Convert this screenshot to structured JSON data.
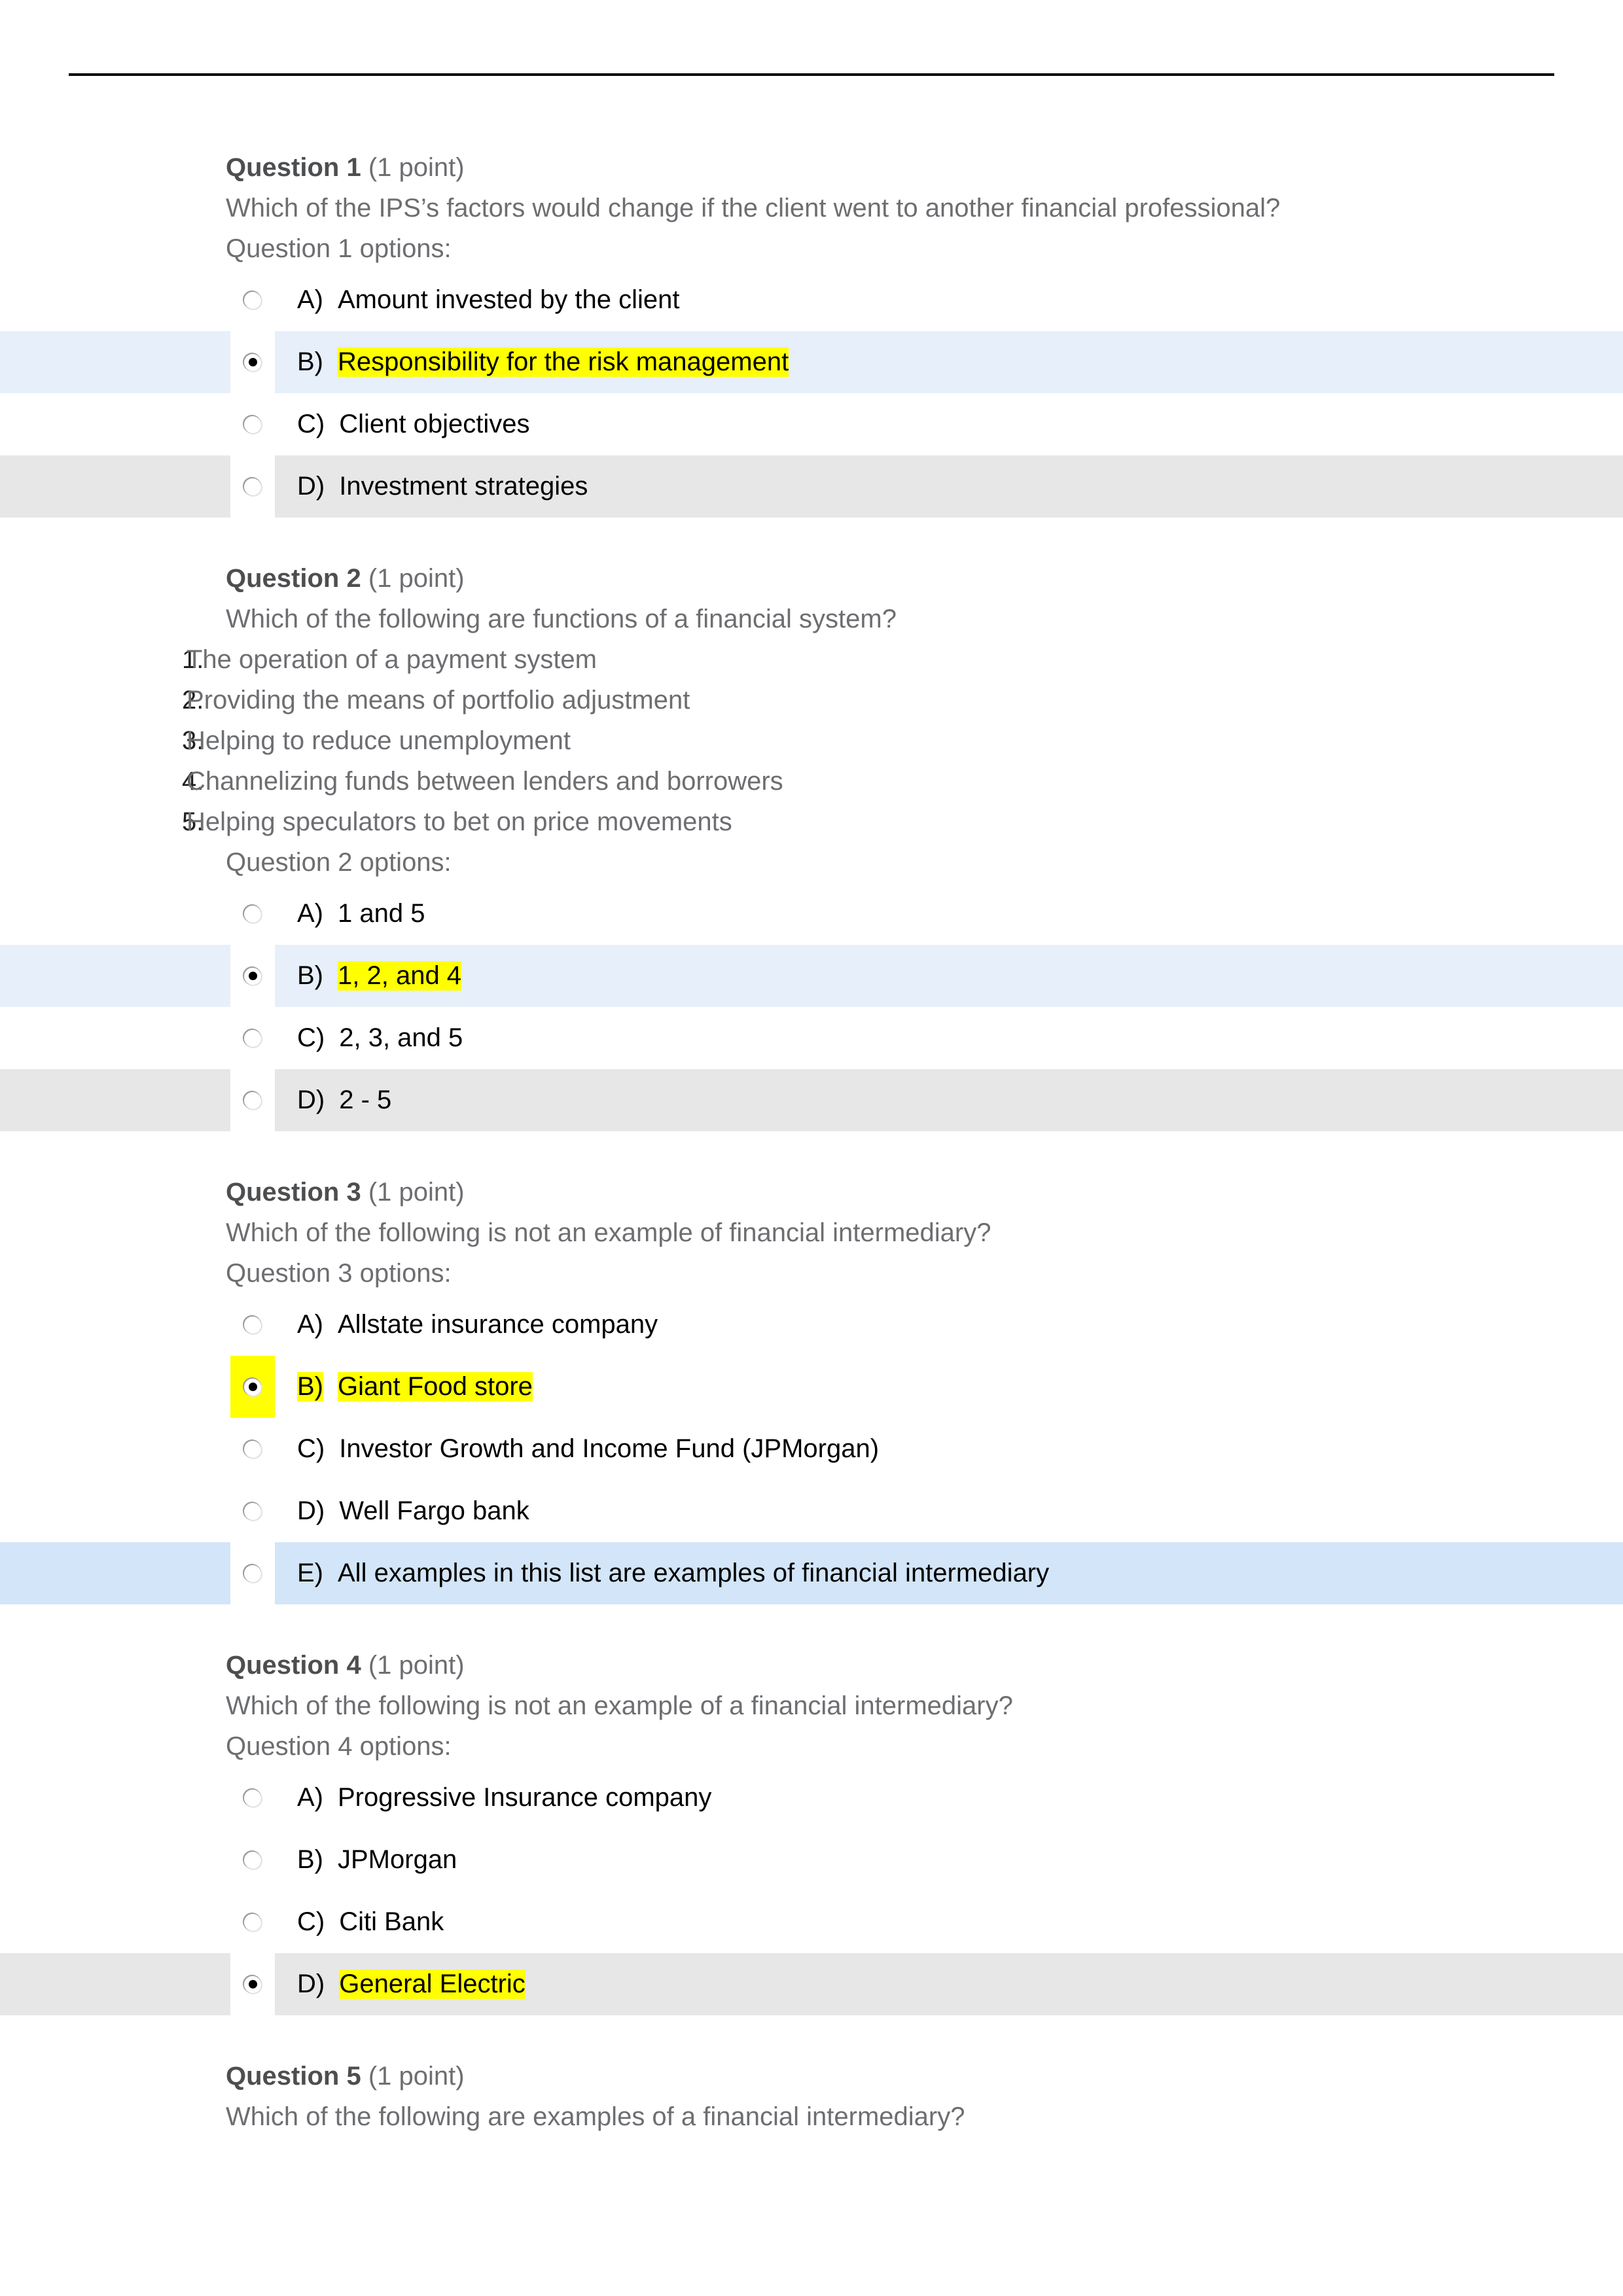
{
  "document": {
    "has_header_rule": true,
    "colors": {
      "row_blue": "#e7effa",
      "row_blue_strong": "#d3e5f8",
      "row_gray": "#e7e7e7",
      "highlight_yellow": "#ffff00",
      "question_text": "#6d6e71",
      "option_text": "#000000"
    }
  },
  "questions": [
    {
      "label": "Question 1",
      "points": "(1 point)",
      "stem": "Which of the IPS’s factors would change if the client went to another financial professional?",
      "options_label": "Question 1 options:",
      "numbered_items": [],
      "options": [
        {
          "letter": "A)",
          "text": "Amount invested by the client",
          "selected": false,
          "row_bg": "white",
          "text_highlighted": false,
          "letter_highlighted": false,
          "radio_highlighted": false
        },
        {
          "letter": "B)",
          "text": "Responsibility for the risk management",
          "selected": true,
          "row_bg": "blue",
          "text_highlighted": true,
          "letter_highlighted": false,
          "radio_highlighted": false
        },
        {
          "letter": "C)",
          "text": "Client objectives",
          "selected": false,
          "row_bg": "white",
          "text_highlighted": false,
          "letter_highlighted": false,
          "radio_highlighted": false
        },
        {
          "letter": "D)",
          "text": "Investment strategies",
          "selected": false,
          "row_bg": "gray",
          "text_highlighted": false,
          "letter_highlighted": false,
          "radio_highlighted": false
        }
      ]
    },
    {
      "label": "Question 2",
      "points": "(1 point)",
      "stem": "Which of the following are functions of a financial system?",
      "options_label": "Question 2 options:",
      "numbered_items": [
        {
          "num": "1.",
          "text": "The operation of a payment system"
        },
        {
          "num": "2.",
          "text": "Providing the means of portfolio adjustment"
        },
        {
          "num": "3.",
          "text": "Helping to reduce unemployment"
        },
        {
          "num": "4.",
          "text": "Channelizing funds between lenders and borrowers"
        },
        {
          "num": "5.",
          "text": "Helping speculators to bet on price movements"
        }
      ],
      "options": [
        {
          "letter": "A)",
          "text": "1 and 5",
          "selected": false,
          "row_bg": "white",
          "text_highlighted": false,
          "letter_highlighted": false,
          "radio_highlighted": false
        },
        {
          "letter": "B)",
          "text": "1, 2, and 4",
          "selected": true,
          "row_bg": "blue",
          "text_highlighted": true,
          "letter_highlighted": false,
          "radio_highlighted": false
        },
        {
          "letter": "C)",
          "text": "2, 3, and 5",
          "selected": false,
          "row_bg": "white",
          "text_highlighted": false,
          "letter_highlighted": false,
          "radio_highlighted": false
        },
        {
          "letter": "D)",
          "text": "2  - 5",
          "selected": false,
          "row_bg": "gray",
          "text_highlighted": false,
          "letter_highlighted": false,
          "radio_highlighted": false
        }
      ]
    },
    {
      "label": "Question 3",
      "points": "(1 point)",
      "stem": "Which of the following is not an example of financial intermediary?",
      "options_label": "Question 3 options:",
      "numbered_items": [],
      "options": [
        {
          "letter": "A)",
          "text": "Allstate insurance company",
          "selected": false,
          "row_bg": "white",
          "text_highlighted": false,
          "letter_highlighted": false,
          "radio_highlighted": false
        },
        {
          "letter": "B)",
          "text": "Giant Food store",
          "selected": true,
          "row_bg": "white",
          "text_highlighted": true,
          "letter_highlighted": true,
          "radio_highlighted": true
        },
        {
          "letter": "C)",
          "text": " Investor Growth and Income Fund (JPMorgan)",
          "selected": false,
          "row_bg": "white",
          "text_highlighted": false,
          "letter_highlighted": false,
          "radio_highlighted": false
        },
        {
          "letter": "D)",
          "text": "Well Fargo bank",
          "selected": false,
          "row_bg": "white",
          "text_highlighted": false,
          "letter_highlighted": false,
          "radio_highlighted": false
        },
        {
          "letter": "E)",
          "text": "All examples in this list are examples of financial intermediary",
          "selected": false,
          "row_bg": "blue2",
          "text_highlighted": false,
          "letter_highlighted": false,
          "radio_highlighted": false
        }
      ]
    },
    {
      "label": "Question 4",
      "points": "(1 point)",
      "stem": "Which of the following is not an example of a financial intermediary?",
      "options_label": "Question 4 options:",
      "numbered_items": [],
      "options": [
        {
          "letter": "A)",
          "text": "Progressive Insurance company",
          "selected": false,
          "row_bg": "white",
          "text_highlighted": false,
          "letter_highlighted": false,
          "radio_highlighted": false
        },
        {
          "letter": "B)",
          "text": "JPMorgan",
          "selected": false,
          "row_bg": "white",
          "text_highlighted": false,
          "letter_highlighted": false,
          "radio_highlighted": false
        },
        {
          "letter": "C)",
          "text": "Citi Bank",
          "selected": false,
          "row_bg": "white",
          "text_highlighted": false,
          "letter_highlighted": false,
          "radio_highlighted": false
        },
        {
          "letter": "D)",
          "text": "General Electric",
          "selected": true,
          "row_bg": "gray",
          "text_highlighted": true,
          "letter_highlighted": false,
          "radio_highlighted": false
        }
      ]
    },
    {
      "label": "Question 5",
      "points": "(1 point)",
      "stem": "Which of the following are examples of a financial intermediary?",
      "options_label": "",
      "numbered_items": [],
      "options": []
    }
  ]
}
